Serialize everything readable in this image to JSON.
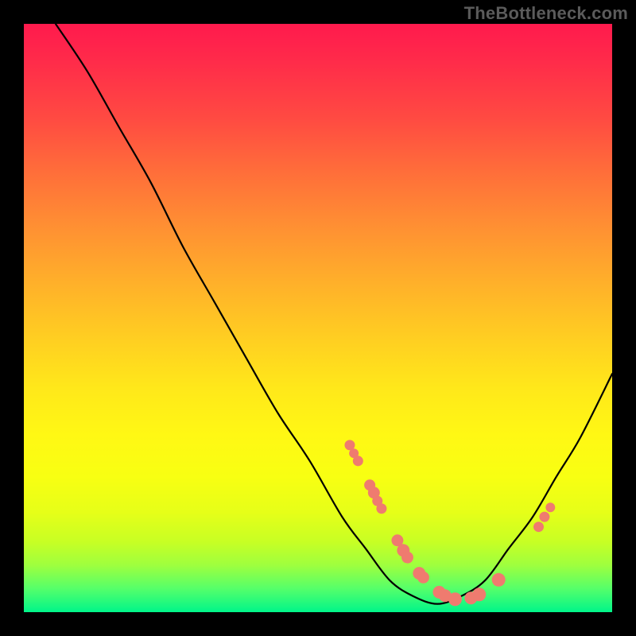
{
  "watermark": "TheBottleneck.com",
  "colors": {
    "background": "#000000",
    "marker": "#ef7b6f",
    "curve": "#000000"
  },
  "chart_data": {
    "type": "line",
    "title": "",
    "xlabel": "",
    "ylabel": "",
    "xlim": [
      0,
      100
    ],
    "ylim": [
      0,
      100
    ],
    "note": "No axis labels or tick labels are rendered; values below are estimated from pixel positions within the 740x740 plot area, x rightward, y = 0 at bottom.",
    "series": [
      {
        "name": "bottleneck-curve",
        "x": [
          5.4,
          10.8,
          16.2,
          21.6,
          27.0,
          32.4,
          37.8,
          43.2,
          48.6,
          54.1,
          58.1,
          62.2,
          66.2,
          70.3,
          74.3,
          78.4,
          82.4,
          86.5,
          90.5,
          94.6,
          100.0
        ],
        "y": [
          100.0,
          91.9,
          82.4,
          73.0,
          62.2,
          52.7,
          43.2,
          33.8,
          25.7,
          16.2,
          10.8,
          5.4,
          2.7,
          1.4,
          2.7,
          5.4,
          10.8,
          16.2,
          23.0,
          29.7,
          40.5
        ]
      }
    ],
    "markers": {
      "name": "highlighted-points",
      "note": "Salmon dots along the curve; r is approximate radius in percent of plot width.",
      "points": [
        {
          "x": 55.4,
          "y": 28.4,
          "r": 0.88
        },
        {
          "x": 56.1,
          "y": 27.0,
          "r": 0.81
        },
        {
          "x": 56.8,
          "y": 25.7,
          "r": 0.88
        },
        {
          "x": 58.8,
          "y": 21.6,
          "r": 0.95
        },
        {
          "x": 59.5,
          "y": 20.3,
          "r": 1.01
        },
        {
          "x": 60.1,
          "y": 18.9,
          "r": 0.88
        },
        {
          "x": 60.8,
          "y": 17.6,
          "r": 0.88
        },
        {
          "x": 63.5,
          "y": 12.2,
          "r": 1.01
        },
        {
          "x": 64.5,
          "y": 10.5,
          "r": 1.08
        },
        {
          "x": 65.2,
          "y": 9.3,
          "r": 1.01
        },
        {
          "x": 67.2,
          "y": 6.6,
          "r": 1.08
        },
        {
          "x": 67.9,
          "y": 5.9,
          "r": 1.01
        },
        {
          "x": 70.6,
          "y": 3.4,
          "r": 1.08
        },
        {
          "x": 71.6,
          "y": 2.8,
          "r": 1.08
        },
        {
          "x": 73.3,
          "y": 2.2,
          "r": 1.15
        },
        {
          "x": 76.0,
          "y": 2.4,
          "r": 1.08
        },
        {
          "x": 77.4,
          "y": 3.0,
          "r": 1.15
        },
        {
          "x": 80.7,
          "y": 5.5,
          "r": 1.15
        },
        {
          "x": 87.5,
          "y": 14.5,
          "r": 0.88
        },
        {
          "x": 88.5,
          "y": 16.2,
          "r": 0.88
        },
        {
          "x": 89.5,
          "y": 17.8,
          "r": 0.81
        }
      ]
    }
  }
}
